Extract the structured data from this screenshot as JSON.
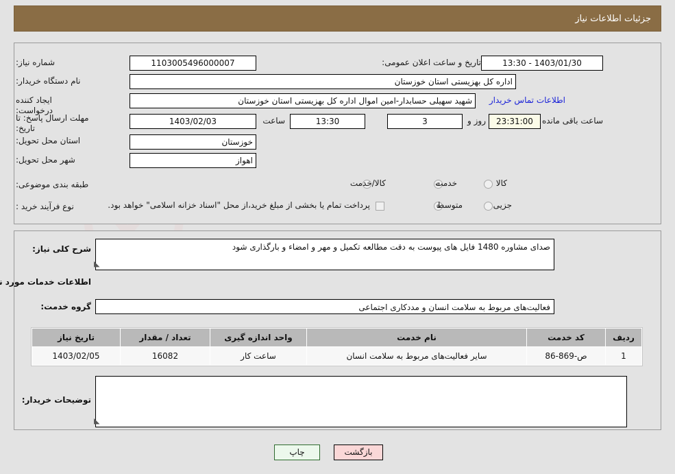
{
  "header": {
    "title": "جزئیات اطلاعات نیاز",
    "bar_color": "#8a6d45"
  },
  "watermarks": {
    "main": "AnaTender.net",
    "secondary": "AnaTender.net"
  },
  "top_panel": {
    "need_number_label": "شماره نیاز:",
    "need_number_value": "1103005496000007",
    "announce_datetime_label": "تاریخ و ساعت اعلان عمومی:",
    "announce_datetime_value": "1403/01/30 - 13:30",
    "buyer_org_label": "نام دستگاه خریدار:",
    "buyer_org_value": "اداره کل بهزیستی استان خوزستان",
    "requester_label": "ایجاد کننده درخواست:",
    "requester_value": "شهید سهیلی حسابدار-امین اموال اداره کل بهزیستی استان خوزستان",
    "contact_link": "اطلاعات تماس خریدار",
    "deadline_label": "مهلت ارسال پاسخ: تا تاریخ:",
    "deadline_date": "1403/02/03",
    "deadline_hour_label": "ساعت",
    "deadline_hour_value": "13:30",
    "days_value": "3",
    "days_label": "روز و",
    "countdown_value": "23:31:00",
    "countdown_label": "ساعت باقی مانده",
    "province_label": "استان محل تحویل:",
    "province_value": "خوزستان",
    "city_label": "شهر محل تحویل:",
    "city_value": "اهواز",
    "category_label": "طبقه بندی موضوعی:",
    "category_options": [
      {
        "label": "کالا",
        "selected": false
      },
      {
        "label": "خدمت",
        "selected": true
      },
      {
        "label": "کالا/خدمت",
        "selected": false
      }
    ],
    "purchase_type_label": "نوع فرآیند خرید :",
    "purchase_type_options": [
      {
        "label": "جزیی",
        "selected": false
      },
      {
        "label": "متوسط",
        "selected": true
      }
    ],
    "treasury_checkbox_label": "پرداخت تمام یا بخشی از مبلغ خرید،از محل \"اسناد خزانه اسلامی\" خواهد بود.",
    "treasury_checked": false
  },
  "mid_panel": {
    "general_desc_label": "شرح کلی نیاز:",
    "general_desc_value": "صدای مشاوره 1480\nفایل های پیوست به دقت مطالعه تکمیل و مهر و امضاء و بارگذاری شود",
    "services_info_title": "اطلاعات خدمات مورد نیاز",
    "service_group_label": "گروه خدمت:",
    "service_group_value": "فعالیت‌های مربوط به سلامت انسان و مددکاری اجتماعی",
    "buyer_notes_label": "توضیحات خریدار:",
    "buyer_notes_value": ""
  },
  "table": {
    "columns": [
      "ردیف",
      "کد خدمت",
      "نام خدمت",
      "واحد اندازه گیری",
      "تعداد / مقدار",
      "تاریخ نیاز"
    ],
    "rows": [
      {
        "row": "1",
        "service_code": "ص-869-86",
        "service_name": "سایر فعالیت‌های مربوط به سلامت انسان",
        "unit": "ساعت کار",
        "quantity": "16082",
        "need_date": "1403/02/05"
      }
    ]
  },
  "footer": {
    "print_label": "چاپ",
    "back_label": "بازگشت"
  }
}
